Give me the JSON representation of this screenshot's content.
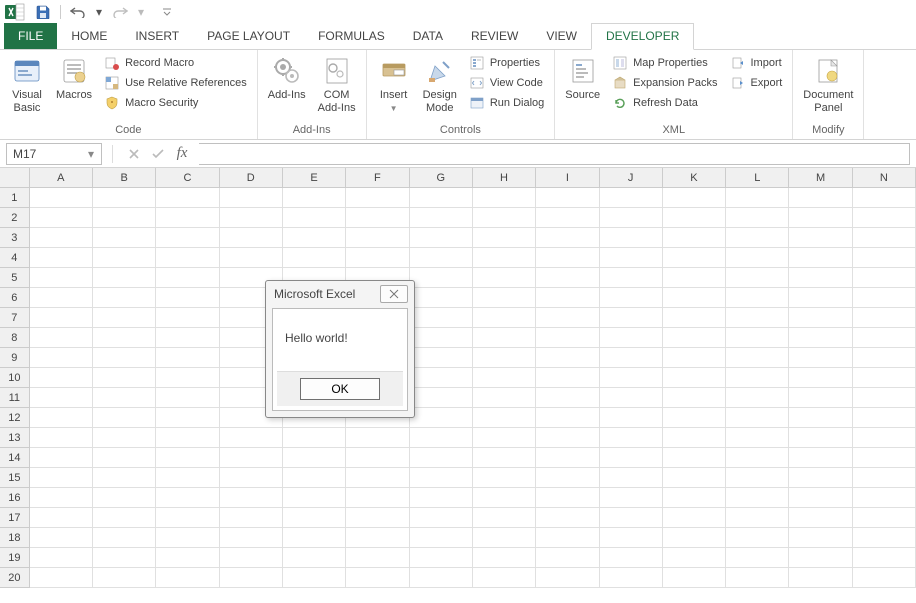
{
  "qat": {
    "undo_tip": "Undo",
    "redo_tip": "Redo",
    "save_tip": "Save"
  },
  "tabs": {
    "file": "FILE",
    "items": [
      "HOME",
      "INSERT",
      "PAGE LAYOUT",
      "FORMULAS",
      "DATA",
      "REVIEW",
      "VIEW",
      "DEVELOPER"
    ],
    "active_index": 7
  },
  "ribbon": {
    "groups": [
      {
        "label": "Code",
        "big": [
          {
            "label": "Visual\nBasic"
          },
          {
            "label": "Macros"
          }
        ],
        "small": [
          {
            "label": "Record Macro"
          },
          {
            "label": "Use Relative References"
          },
          {
            "label": "Macro Security"
          }
        ]
      },
      {
        "label": "Add-Ins",
        "big": [
          {
            "label": "Add-Ins"
          },
          {
            "label": "COM\nAdd-Ins"
          }
        ],
        "small": []
      },
      {
        "label": "Controls",
        "big": [
          {
            "label": "Insert"
          },
          {
            "label": "Design\nMode"
          }
        ],
        "small": [
          {
            "label": "Properties"
          },
          {
            "label": "View Code"
          },
          {
            "label": "Run Dialog"
          }
        ]
      },
      {
        "label": "XML",
        "big": [
          {
            "label": "Source"
          }
        ],
        "small": [
          {
            "label": "Map Properties"
          },
          {
            "label": "Expansion Packs"
          },
          {
            "label": "Refresh Data"
          }
        ],
        "small2": [
          {
            "label": "Import"
          },
          {
            "label": "Export"
          }
        ]
      },
      {
        "label": "Modify",
        "big": [
          {
            "label": "Document\nPanel"
          }
        ],
        "small": []
      }
    ]
  },
  "formula_bar": {
    "name_box": "M17",
    "fx_label": "fx",
    "value": ""
  },
  "grid": {
    "columns": [
      "A",
      "B",
      "C",
      "D",
      "E",
      "F",
      "G",
      "H",
      "I",
      "J",
      "K",
      "L",
      "M",
      "N"
    ],
    "rows": [
      1,
      2,
      3,
      4,
      5,
      6,
      7,
      8,
      9,
      10,
      11,
      12,
      13,
      14,
      15,
      16,
      17,
      18,
      19,
      20
    ]
  },
  "dialog": {
    "title": "Microsoft Excel",
    "message": "Hello world!",
    "ok": "OK"
  }
}
